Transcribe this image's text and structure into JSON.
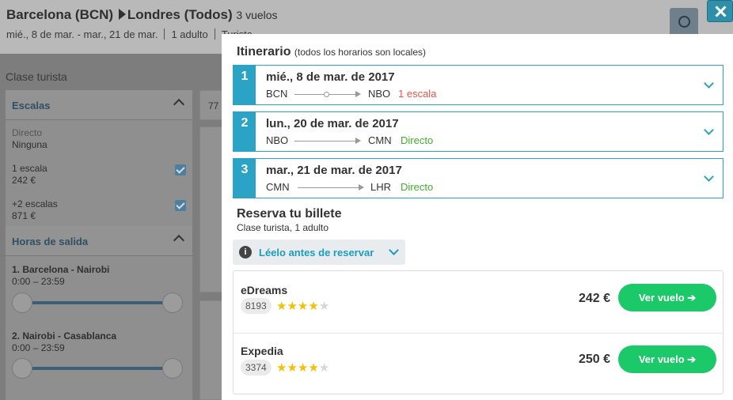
{
  "background": {
    "origin": "Barcelona (BCN)",
    "destination": "Londres (Todos)",
    "flights_count": "3 vuelos",
    "dates": "mié., 8 de mar. - mar., 21 de mar.",
    "passengers": "1 adulto",
    "cabin": "Turista",
    "class_label": "Clase turista",
    "filters": {
      "stops_title": "Escalas",
      "options": [
        {
          "label": "Directo",
          "value": "Ninguna",
          "checked": false
        },
        {
          "label": "1 escala",
          "value": "242 €",
          "checked": true
        },
        {
          "label": "+2 escalas",
          "value": "871 €",
          "checked": true
        }
      ],
      "departure_title": "Horas de salida",
      "routes": [
        {
          "label": "1. Barcelona - Nairobi",
          "range": "0:00 – 23:59"
        },
        {
          "label": "2. Nairobi - Casablanca",
          "range": "0:00 – 23:59"
        }
      ]
    },
    "result_peek": "77"
  },
  "modal": {
    "title": "Itinerario",
    "title_note": "(todos los horarios son locales)",
    "legs": [
      {
        "num": "1",
        "date": "mié., 8 de mar. de 2017",
        "from": "BCN",
        "to": "NBO",
        "stops": "1 escala",
        "stops_color": "#e8544a"
      },
      {
        "num": "2",
        "date": "lun., 20 de mar. de 2017",
        "from": "NBO",
        "to": "CMN",
        "stops": "Directo",
        "stops_color": "#3fae2a"
      },
      {
        "num": "3",
        "date": "mar., 21 de mar. de 2017",
        "from": "CMN",
        "to": "LHR",
        "stops": "Directo",
        "stops_color": "#3fae2a"
      }
    ],
    "booking": {
      "title": "Reserva tu billete",
      "subtitle": "Clase turista, 1 adulto",
      "info_label": "Léelo antes de reservar",
      "offers": [
        {
          "provider": "eDreams",
          "reviews": "8193",
          "rating": 4,
          "max_rating": 5,
          "price": "242 €",
          "button": "Ver vuelo ➔"
        },
        {
          "provider": "Expedia",
          "reviews": "3374",
          "rating": 4,
          "max_rating": 5,
          "price": "250 €",
          "button": "Ver vuelo ➔"
        }
      ]
    }
  },
  "colors": {
    "accent": "#2aa3c4",
    "button": "#1cc968",
    "star": "#f5c000"
  }
}
